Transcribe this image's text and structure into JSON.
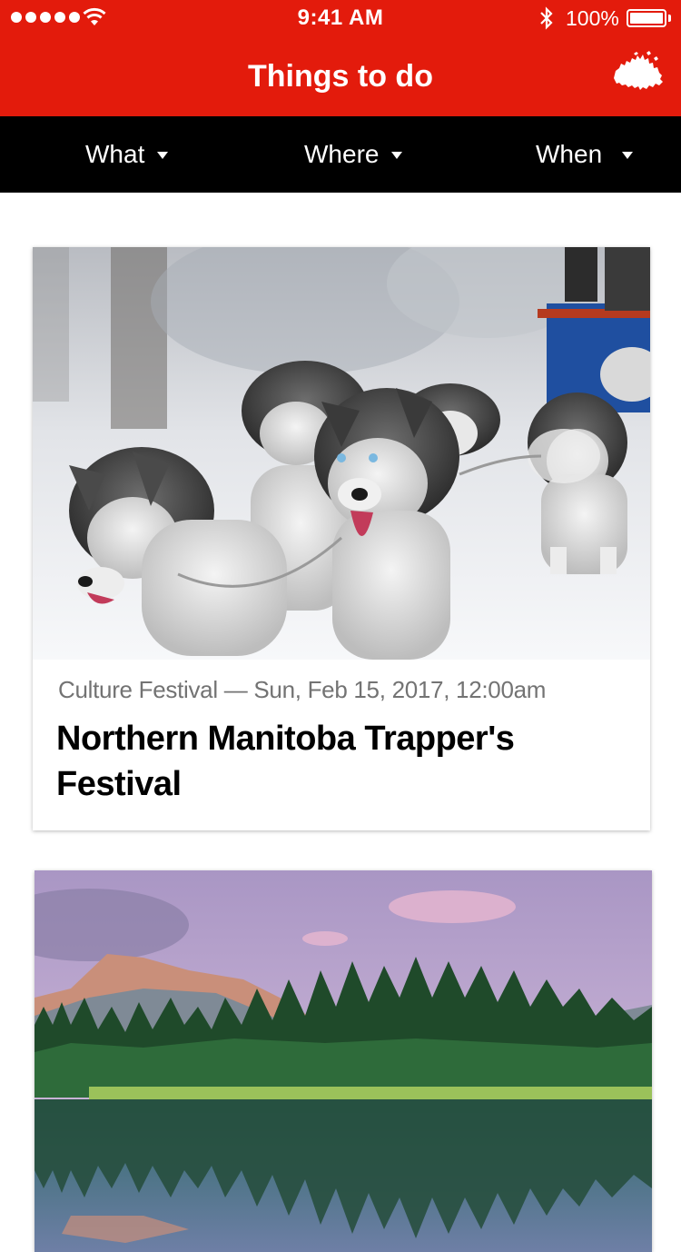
{
  "status_bar": {
    "time": "9:41 AM",
    "battery": "100%"
  },
  "header": {
    "title": "Things to do",
    "map_icon": "canada-map-icon"
  },
  "filters": [
    {
      "label": "What"
    },
    {
      "label": "Where"
    },
    {
      "label": "When"
    }
  ],
  "cards": [
    {
      "meta": "Culture Festival — Sun, Feb 15, 2017, 12:00am",
      "title": "Northern Manitoba Trapper's Festival",
      "image": "sled-dogs-in-snow"
    },
    {
      "image": "mountain-lake-forest"
    }
  ],
  "colors": {
    "header_red": "#e31b0c",
    "filter_bar": "#000000",
    "meta_gray": "#737373"
  }
}
